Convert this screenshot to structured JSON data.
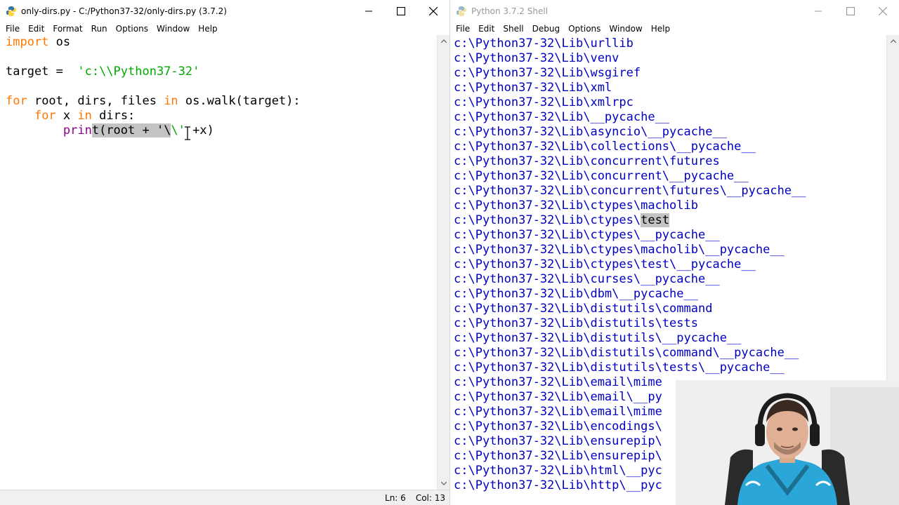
{
  "editor": {
    "title": "only-dirs.py - C:/Python37-32/only-dirs.py (3.7.2)",
    "menu": [
      "File",
      "Edit",
      "Format",
      "Run",
      "Options",
      "Window",
      "Help"
    ],
    "code": {
      "line1_kw": "import",
      "line1_rest": " os",
      "line3_pre": "target =  ",
      "line3_str": "'c:\\\\Python37-32'",
      "line5_kw1": "for",
      "line5_a": " root, dirs, files ",
      "line5_kw2": "in",
      "line5_b": " os.walk(target):",
      "line6_indent": "    ",
      "line6_kw1": "for",
      "line6_a": " x ",
      "line6_kw2": "in",
      "line6_b": " dirs:",
      "line7_indent": "        ",
      "line7_bi": "prin",
      "line7_sel": "t(root + '\\",
      "line7_str": "\\'",
      "line7_rest": " +x)"
    },
    "status": {
      "line": "Ln: 6",
      "col": "Col: 13"
    }
  },
  "shell": {
    "title": "Python 3.7.2 Shell",
    "menu": [
      "File",
      "Edit",
      "Shell",
      "Debug",
      "Options",
      "Window",
      "Help"
    ],
    "lines": [
      "c:\\Python37-32\\Lib\\urllib",
      "c:\\Python37-32\\Lib\\venv",
      "c:\\Python37-32\\Lib\\wsgiref",
      "c:\\Python37-32\\Lib\\xml",
      "c:\\Python37-32\\Lib\\xmlrpc",
      "c:\\Python37-32\\Lib\\__pycache__",
      "c:\\Python37-32\\Lib\\asyncio\\__pycache__",
      "c:\\Python37-32\\Lib\\collections\\__pycache__",
      "c:\\Python37-32\\Lib\\concurrent\\futures",
      "c:\\Python37-32\\Lib\\concurrent\\__pycache__",
      "c:\\Python37-32\\Lib\\concurrent\\futures\\__pycache__",
      "c:\\Python37-32\\Lib\\ctypes\\macholib",
      "c:\\Python37-32\\Lib\\ctypes\\test",
      "c:\\Python37-32\\Lib\\ctypes\\__pycache__",
      "c:\\Python37-32\\Lib\\ctypes\\macholib\\__pycache__",
      "c:\\Python37-32\\Lib\\ctypes\\test\\__pycache__",
      "c:\\Python37-32\\Lib\\curses\\__pycache__",
      "c:\\Python37-32\\Lib\\dbm\\__pycache__",
      "c:\\Python37-32\\Lib\\distutils\\command",
      "c:\\Python37-32\\Lib\\distutils\\tests",
      "c:\\Python37-32\\Lib\\distutils\\__pycache__",
      "c:\\Python37-32\\Lib\\distutils\\command\\__pycache__",
      "c:\\Python37-32\\Lib\\distutils\\tests\\__pycache__",
      "c:\\Python37-32\\Lib\\email\\mime",
      "c:\\Python37-32\\Lib\\email\\__py",
      "c:\\Python37-32\\Lib\\email\\mime",
      "c:\\Python37-32\\Lib\\encodings\\",
      "c:\\Python37-32\\Lib\\ensurepip\\",
      "c:\\Python37-32\\Lib\\ensurepip\\",
      "c:\\Python37-32\\Lib\\html\\__pyc",
      "c:\\Python37-32\\Lib\\http\\__pyc"
    ],
    "highlight_line_index": 12,
    "highlight_prefix": "c:\\Python37-32\\Lib\\ctypes\\",
    "highlight_word": "test"
  },
  "colors": {
    "keyword": "#ff7700",
    "string": "#00aa00",
    "builtin": "#900090",
    "shell_output": "#0000c0",
    "selection": "#c3c3c3"
  }
}
